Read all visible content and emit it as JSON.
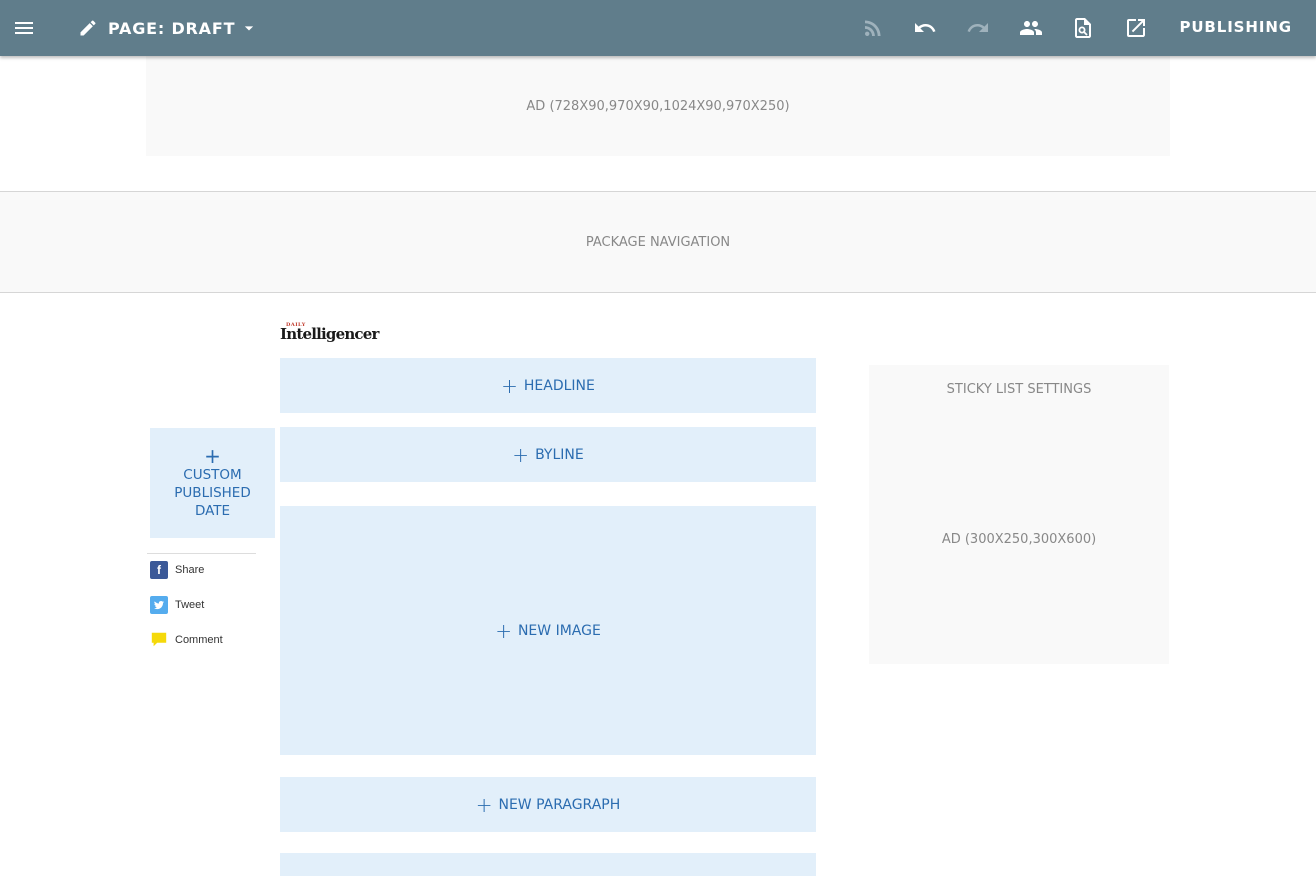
{
  "toolbar": {
    "page_title": "PAGE: DRAFT",
    "publishing_label": "PUBLISHING",
    "icons": [
      "menu-icon",
      "pencil-icon",
      "caret-down-icon",
      "rss-icon",
      "undo-icon",
      "redo-icon",
      "people-icon",
      "preview-icon",
      "open-external-icon"
    ]
  },
  "ads": {
    "top": "AD (728X90,970X90,1024X90,970X250)",
    "sidebar": "AD (300X250,300X600)"
  },
  "package_nav": "PACKAGE NAVIGATION",
  "logo": {
    "small": "DAILY",
    "big": "Intelligencer"
  },
  "blocks": {
    "headline": "HEADLINE",
    "byline": "BYLINE",
    "new_image": "NEW IMAGE",
    "new_paragraph": "NEW PARAGRAPH"
  },
  "custom_date": [
    "CUSTOM",
    "PUBLISHED",
    "DATE"
  ],
  "share": {
    "facebook": "Share",
    "twitter": "Tweet",
    "comment": "Comment"
  },
  "sidebar": {
    "sticky": "STICKY LIST SETTINGS"
  },
  "colors": {
    "toolbar": "#607d8b",
    "add_block_bg": "#e2effa",
    "add_block_text": "#2b6cb0",
    "facebook": "#3b5998",
    "twitter": "#55acee",
    "comment": "#f5d90a"
  }
}
